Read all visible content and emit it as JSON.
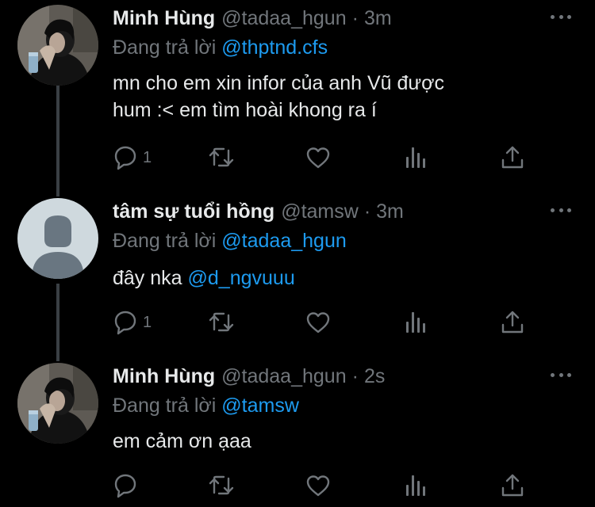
{
  "tweets": [
    {
      "name": "Minh Hùng",
      "handle": "@tadaa_hgun",
      "separator": "·",
      "time": "3m",
      "reply_prefix": "Đang trả lời",
      "reply_to": "@thptnd.cfs",
      "text_lines": [
        "mn cho em xin infor của anh Vũ được",
        "hum :< em tìm hoài khong ra í"
      ],
      "reply_count": "1",
      "avatar": "photo"
    },
    {
      "name": "tâm sự tuổi hồng",
      "handle": "@tamsw",
      "separator": "·",
      "time": "3m",
      "reply_prefix": "Đang trả lời",
      "reply_to": "@tadaa_hgun",
      "text_plain": "đây nka ",
      "text_mention": "@d_ngvuuu",
      "reply_count": "1",
      "avatar": "default-profile"
    },
    {
      "name": "Minh Hùng",
      "handle": "@tadaa_hgun",
      "separator": "·",
      "time": "2s",
      "reply_prefix": "Đang trả lời",
      "reply_to": "@tamsw",
      "text_lines": [
        "em cảm ơn ạaa"
      ],
      "reply_count": "",
      "avatar": "photo"
    }
  ],
  "colors": {
    "background": "#000000",
    "text": "#e7e9ea",
    "secondary": "#71767b",
    "mention": "#1d9bf0",
    "thread_line": "#3a3f44"
  },
  "icons": [
    "reply-icon",
    "retweet-icon",
    "like-icon",
    "views-icon",
    "share-icon",
    "more-icon"
  ]
}
